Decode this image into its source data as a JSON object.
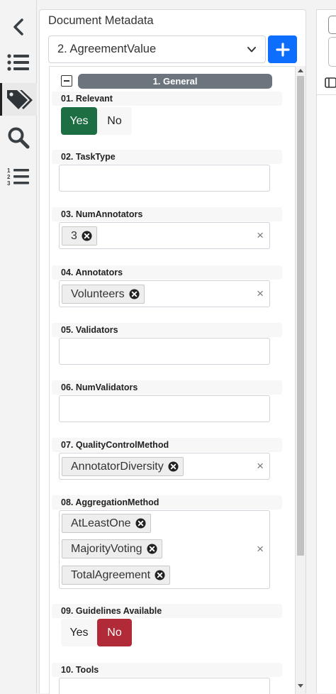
{
  "rail": {
    "items": [
      {
        "icon": "chevron-left-icon"
      },
      {
        "icon": "list-icon"
      },
      {
        "icon": "tags-icon",
        "active": true
      },
      {
        "icon": "search-icon"
      },
      {
        "icon": "numbered-list-icon"
      }
    ]
  },
  "panel": {
    "title": "Document Metadata",
    "selector_value": "2. AgreementValue",
    "add_label": "+"
  },
  "group": {
    "title": "1. General"
  },
  "fields": {
    "relevant": {
      "label": "01. Relevant",
      "yes": "Yes",
      "no": "No",
      "selected": "Yes"
    },
    "task_type": {
      "label": "02. TaskType",
      "value": ""
    },
    "num_annotators": {
      "label": "03. NumAnnotators",
      "chips": [
        "3"
      ]
    },
    "annotators": {
      "label": "04. Annotators",
      "chips": [
        "Volunteers"
      ]
    },
    "validators": {
      "label": "05. Validators",
      "value": ""
    },
    "num_validators": {
      "label": "06. NumValidators",
      "value": ""
    },
    "quality_control": {
      "label": "07. QualityControlMethod",
      "chips": [
        "AnnotatorDiversity"
      ]
    },
    "aggregation": {
      "label": "08. AggregationMethod",
      "chips": [
        "AtLeastOne",
        "MajorityVoting",
        "TotalAgreement"
      ]
    },
    "guidelines": {
      "label": "09. Guidelines Available",
      "yes": "Yes",
      "no": "No",
      "selected": "No"
    },
    "tools": {
      "label": "10. Tools",
      "value": ""
    }
  },
  "clear_symbol": "×",
  "colors": {
    "accent": "#0d6efd",
    "yes": "#1e6e43",
    "no": "#b02a37",
    "group": "#6c757d"
  }
}
